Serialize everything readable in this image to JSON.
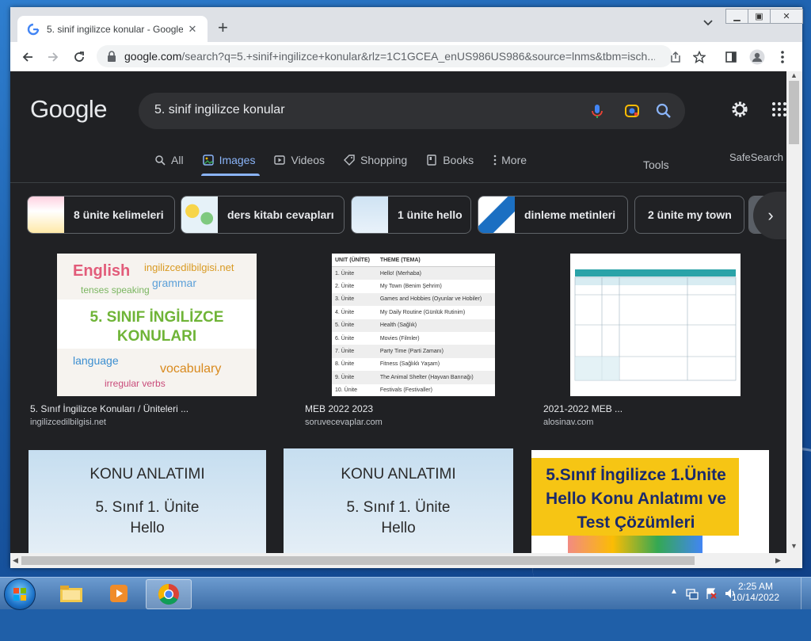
{
  "browser": {
    "tab_title": "5. sinif ingilizce konular - Google",
    "tab_close": "✕",
    "new_tab": "+",
    "url_host": "google.com",
    "url_rest": "/search?q=5.+sinif+ingilizce+konular&rlz=1C1GCEA_enUS986US986&source=lnms&tbm=isch..."
  },
  "google": {
    "logo": "Google",
    "query": "5. sinif ingilizce konular",
    "tabs": [
      {
        "label": "All",
        "icon": "search-icon"
      },
      {
        "label": "Images",
        "icon": "image-icon",
        "active": true
      },
      {
        "label": "Videos",
        "icon": "video-icon"
      },
      {
        "label": "Shopping",
        "icon": "tag-icon"
      },
      {
        "label": "Books",
        "icon": "book-icon"
      },
      {
        "label": "More",
        "icon": "more-vert-icon"
      }
    ],
    "tools": "Tools",
    "safesearch": "SafeSearch o",
    "chips": [
      {
        "label": "8 ünite kelimeleri"
      },
      {
        "label": "ders kitabı cevapları"
      },
      {
        "label": "1 ünite hello"
      },
      {
        "label": "dinleme metinleri"
      },
      {
        "label": "2 ünite my town"
      }
    ],
    "chip_next": "›"
  },
  "results": [
    {
      "title": "5. Sınıf İngilizce Konuları / Üniteleri ...",
      "site": "ingilizcedilbilgisi.net",
      "image_text": "5. SINIF İNGİLİZCE KONULARI"
    },
    {
      "title": "MEB 2022 2023",
      "site": "soruvecevaplar.com",
      "table_head": [
        "UNIT (ÜNİTE)",
        "THEME (TEMA)"
      ],
      "table_rows": [
        [
          "1. Ünite",
          "Hello! (Merhaba)"
        ],
        [
          "2. Ünite",
          "My Town (Benim Şehrim)"
        ],
        [
          "3. Ünite",
          "Games and Hobbies (Oyunlar ve Hobiler)"
        ],
        [
          "4. Ünite",
          "My Daily Routine (Günlük Rutinim)"
        ],
        [
          "5. Ünite",
          "Health (Sağlık)"
        ],
        [
          "6. Ünite",
          "Movies (Filmler)"
        ],
        [
          "7. Ünite",
          "Party Time (Parti Zamanı)"
        ],
        [
          "8. Ünite",
          "Fitness (Sağlıklı Yaşam)"
        ],
        [
          "9. Ünite",
          "The Animal Shelter (Hayvan Barınağı)"
        ],
        [
          "10. Ünite",
          "Festivals (Festivaller)"
        ]
      ]
    },
    {
      "title": "2021-2022 MEB ...",
      "site": "alosinav.com"
    },
    {
      "image_line1": "KONU ANLATIMI",
      "image_line2": "5. Sınıf 1. Ünite",
      "image_line3": "Hello"
    },
    {
      "image_line1": "KONU ANLATIMI",
      "image_line2": "5. Sınıf 1. Ünite",
      "image_line3": "Hello"
    },
    {
      "image_text": "5.Sınıf İngilizce 1.Ünite Hello Konu Anlatımı ve Test Çözümleri"
    }
  ],
  "taskbar": {
    "time": "2:25 AM",
    "date": "10/14/2022"
  }
}
